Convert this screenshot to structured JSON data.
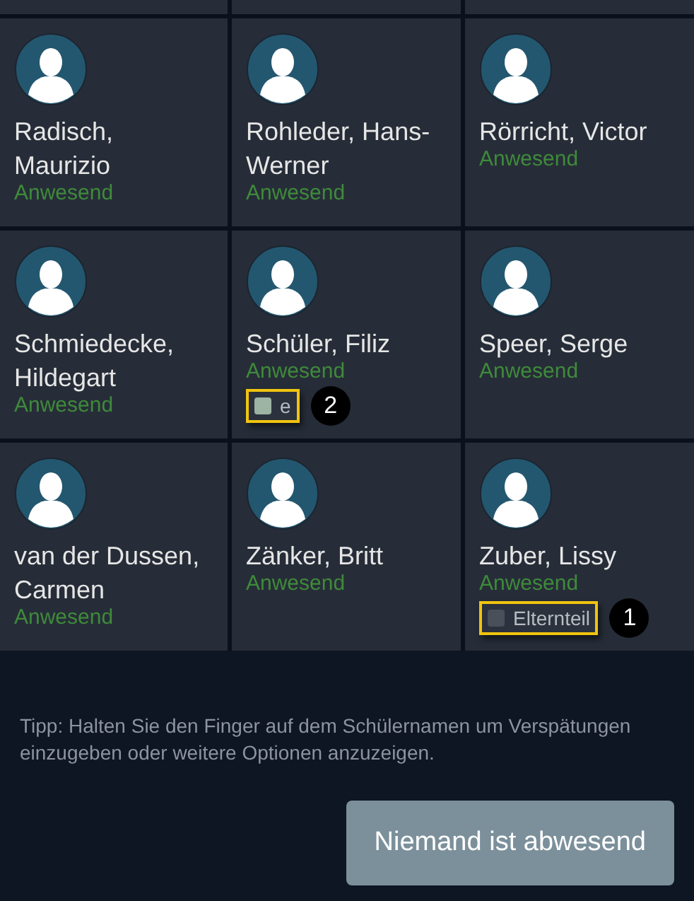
{
  "students": [
    {
      "name": "Radisch, Maurizio",
      "status": "Anwesend"
    },
    {
      "name": "Rohleder, Hans-Werner",
      "status": "Anwesend"
    },
    {
      "name": "Rörricht, Victor",
      "status": "Anwesend"
    },
    {
      "name": "Schmiedecke, Hildegart",
      "status": "Anwesend"
    },
    {
      "name": "Schüler, Filiz",
      "status": "Anwesend",
      "option": {
        "label": "e",
        "highlighted": true,
        "callout": "2"
      }
    },
    {
      "name": "Speer, Serge",
      "status": "Anwesend"
    },
    {
      "name": "van der Dussen, Carmen",
      "status": "Anwesend"
    },
    {
      "name": "Zänker, Britt",
      "status": "Anwesend"
    },
    {
      "name": "Zuber, Lissy",
      "status": "Anwesend",
      "option": {
        "label": "Elternteil",
        "highlighted": false,
        "callout": "1"
      }
    }
  ],
  "tip": "Tipp: Halten Sie den Finger auf dem Schülernamen um Verspätungen einzugeben oder weitere Optionen anzuzeigen.",
  "button": "Niemand ist abwesend"
}
